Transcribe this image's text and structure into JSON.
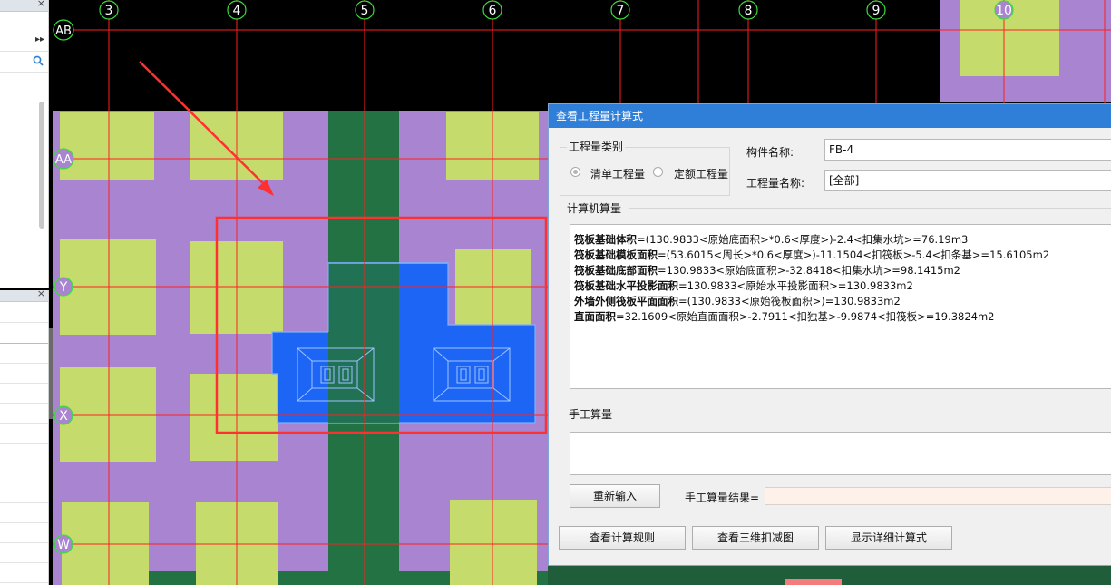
{
  "grid": {
    "columns": [
      "3",
      "4",
      "5",
      "6",
      "7",
      "8",
      "9",
      "10"
    ],
    "rows": [
      "AB",
      "AA",
      "Y",
      "X",
      "W"
    ]
  },
  "colors": {
    "background": "#000000",
    "purple": "#a984d0",
    "green": "#227243",
    "lime": "#c5dc6d",
    "blue": "#1d66f5",
    "grid_line": "#ff2020",
    "highlight": "#ff3030",
    "dialog_title": "#2f7fd9"
  },
  "dialog": {
    "title": "查看工程量计算式",
    "quantity_type_label": "工程量类别",
    "radio_list": "清单工程量",
    "radio_quota": "定额工程量",
    "component_name_label": "构件名称:",
    "component_name_value": "FB-4",
    "quantity_name_label": "工程量名称:",
    "quantity_name_value": "[全部]",
    "computer_calc_label": "计算机算量",
    "formulas": [
      {
        "name": "筏板基础体积",
        "expr": "=(130.9833<原始底面积>*0.6<厚度>)-2.4<扣集水坑>=76.19m3"
      },
      {
        "name": "筏板基础模板面积",
        "expr": "=(53.6015<周长>*0.6<厚度>)-11.1504<扣筏板>-5.4<扣条基>=15.6105m2"
      },
      {
        "name": "筏板基础底部面积",
        "expr": "=130.9833<原始底面积>-32.8418<扣集水坑>=98.1415m2"
      },
      {
        "name": "筏板基础水平投影面积",
        "expr": "=130.9833<原始水平投影面积>=130.9833m2"
      },
      {
        "name": "外墙外侧筏板平面面积",
        "expr": "=(130.9833<原始筏板面积>)=130.9833m2"
      },
      {
        "name": "直面面积",
        "expr": "=32.1609<原始直面面积>-2.7911<扣独基>-9.9874<扣筏板>=19.3824m2"
      }
    ],
    "manual_calc_label": "手工算量",
    "reenter_button": "重新输入",
    "manual_result_label": "手工算量结果=",
    "view_rules_button": "查看计算规则",
    "view_3d_button": "查看三维扣减图",
    "show_detail_button": "显示详细计算式"
  }
}
